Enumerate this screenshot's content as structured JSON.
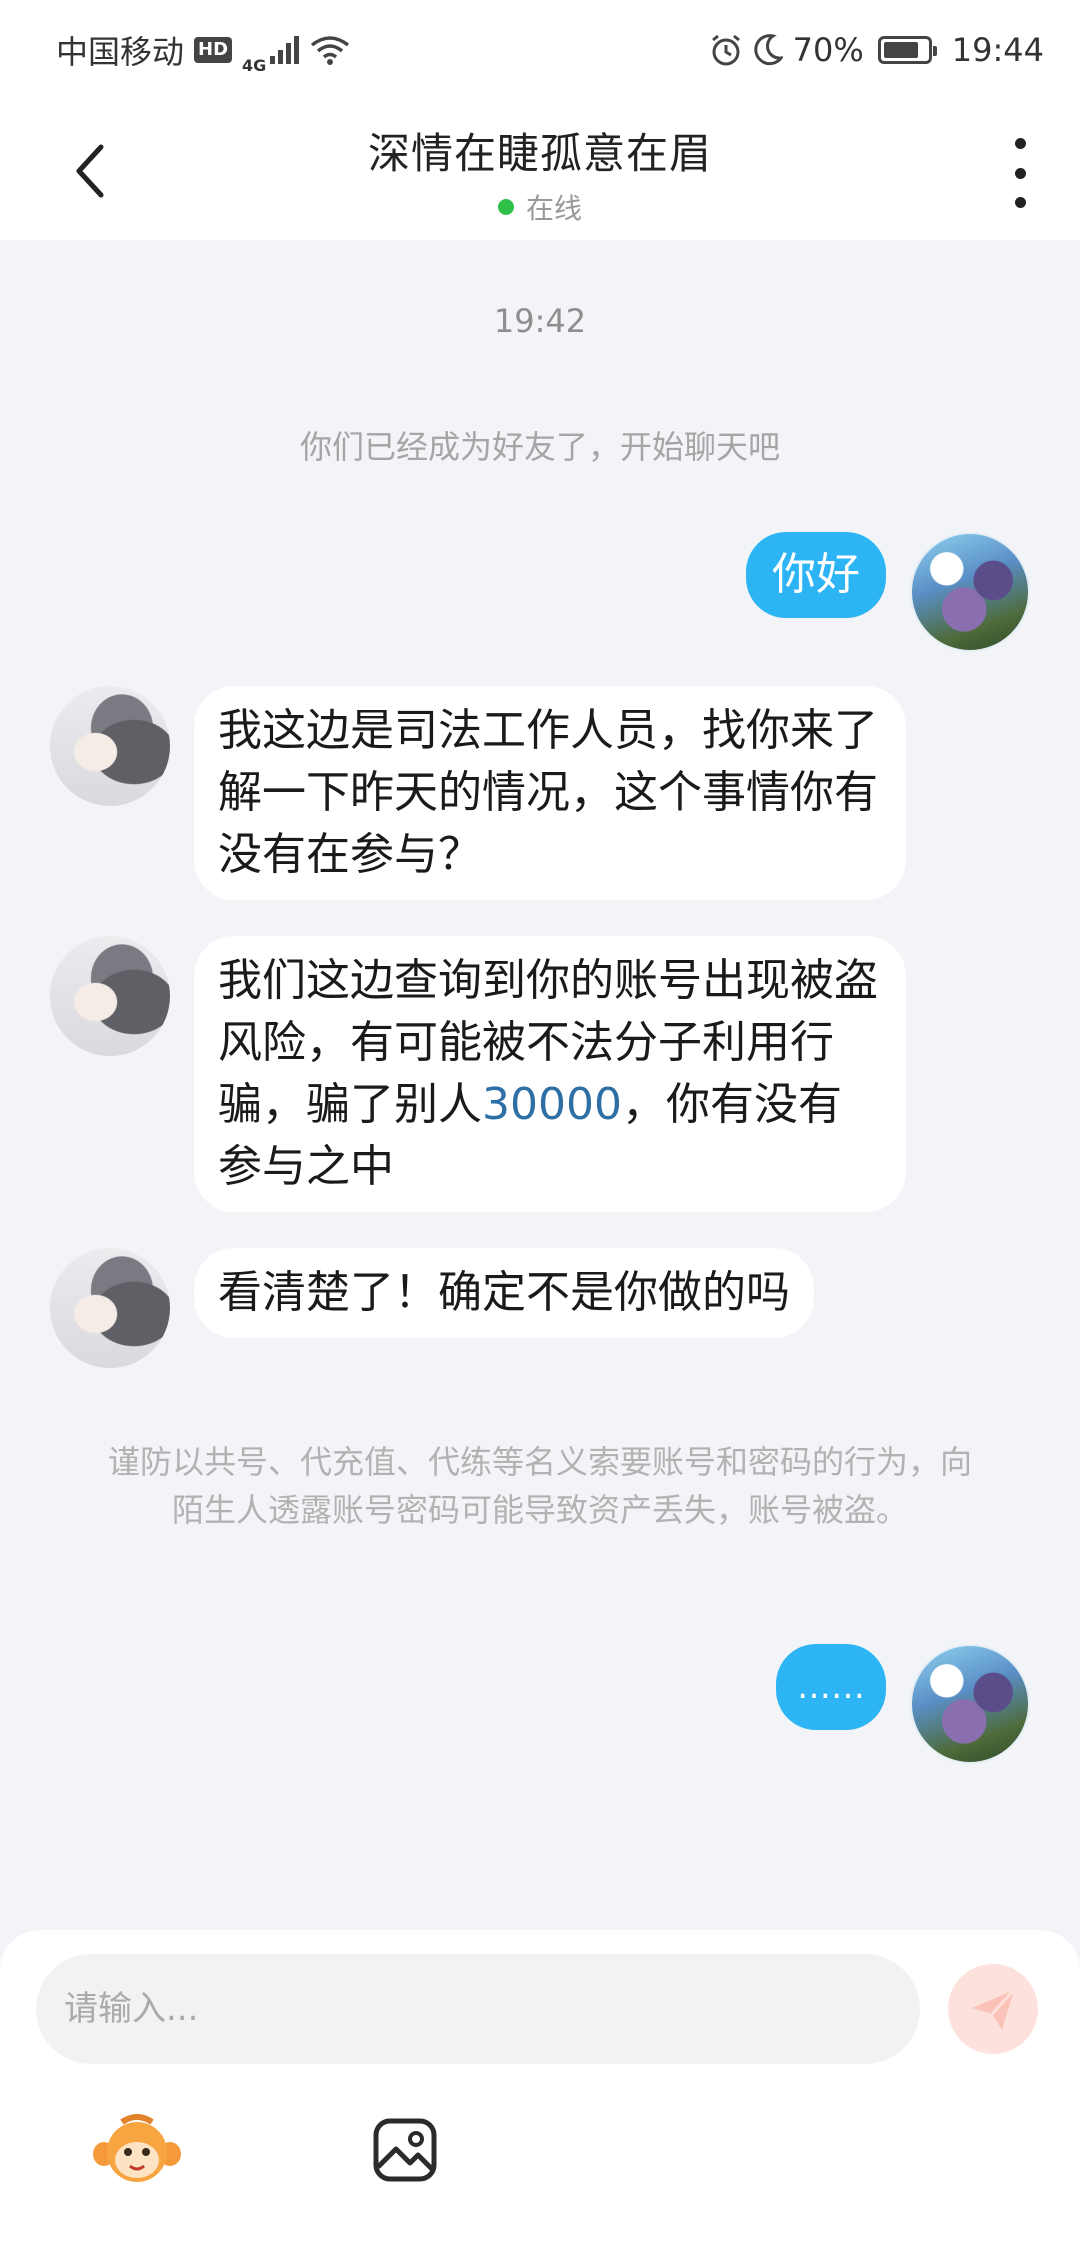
{
  "status_bar": {
    "carrier": "中国移动",
    "hd": "HD",
    "network": "4G",
    "battery": "70%",
    "battery_level": 0.7,
    "time": "19:44"
  },
  "header": {
    "title": "深情在睫孤意在眉",
    "status": "在线"
  },
  "chat": {
    "time_label": "19:42",
    "system_note": "你们已经成为好友了，开始聊天吧",
    "messages": [
      {
        "from": "self",
        "text": "你好"
      },
      {
        "from": "other",
        "text": "我这边是司法工作人员，找你来了解一下昨天的情况，这个事情你有没有在参与？"
      },
      {
        "from": "other",
        "text_before": "我们这边查询到你的账号出现被盗风险，有可能被不法分子利用行骗，骗了别人",
        "highlight": "30000",
        "text_after": "，你有没有参与之中"
      },
      {
        "from": "other",
        "text": "看清楚了！确定不是你做的吗"
      },
      {
        "from": "self",
        "text": "……"
      }
    ],
    "warning": "谨防以共号、代充值、代练等名义索要账号和密码的行为，向陌生人透露账号密码可能导致资产丢失，账号被盗。"
  },
  "composer": {
    "placeholder": "请输入..."
  },
  "colors": {
    "accent_blue": "#2cb4f5",
    "send_button_bg": "#fde1dc",
    "online_green": "#2fc14a",
    "highlight_number": "#2e6fa6"
  },
  "icons": {
    "back": "chevron-left-icon",
    "more": "more-vertical-icon",
    "send": "paper-plane-icon",
    "emoji": "monkey-emoji-icon",
    "image": "image-icon"
  }
}
